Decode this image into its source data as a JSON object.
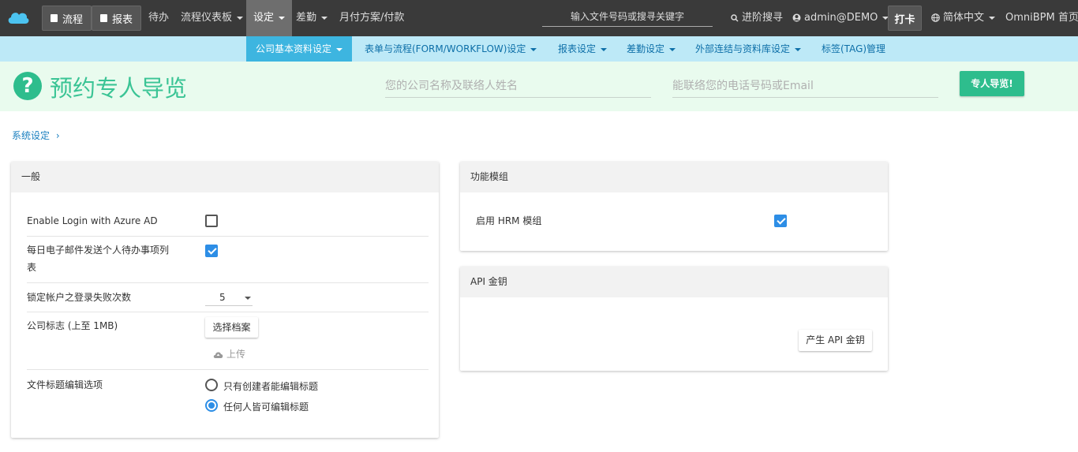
{
  "colors": {
    "topbar": "#3a3a3a",
    "subbar": "#bde9f7",
    "accent": "#3db5e0",
    "banner_bg": "#e9fbee",
    "banner_green": "#2ebd8d",
    "checkbox_blue": "#2d8ee6"
  },
  "topnav": {
    "logo_icon": "cloud-logo-icon",
    "workflow_btn": "流程",
    "report_btn": "报表",
    "todo": "待办",
    "dashboard": "流程仪表板",
    "settings": "设定",
    "attendance": "差勤",
    "billing": "月付方案/付款",
    "search_placeholder": "输入文件号码或搜寻关键字",
    "advanced_search": "进阶搜寻",
    "user": "admin@DEMO",
    "clock_in": "打卡",
    "language": "简体中文",
    "home": "OmniBPM 首页"
  },
  "subnav": {
    "items": [
      "公司基本资料设定",
      "表单与流程(FORM/WORKFLOW)设定",
      "报表设定",
      "差勤设定",
      "外部连结与资料库设定",
      "标签(TAG)管理"
    ]
  },
  "banner": {
    "title": "预约专人导览",
    "name_placeholder": "您的公司名称及联络人姓名",
    "contact_placeholder": "能联络您的电话号码或Email",
    "button": "专人导览!"
  },
  "breadcrumb": {
    "label": "系统设定",
    "separator": "›"
  },
  "general_panel": {
    "title": "一般",
    "azure_label": "Enable Login with Azure AD",
    "azure_checked": false,
    "email_label_line1": "每日电子邮件发送个人待办事项列",
    "email_label_line2": "表",
    "email_checked": true,
    "lock_label": "锁定帐户之登录失败次数",
    "lock_value": "5",
    "logo_label": "公司标志 (上至 1MB)",
    "choose_file": "选择档案",
    "upload": "上传",
    "title_edit_label": "文件标题编辑选项",
    "radio_option1": "只有创建者能编辑标题",
    "radio_option2": "任何人皆可编辑标题",
    "radio_selected": 2
  },
  "modules_panel": {
    "title": "功能模组",
    "hrm_label": "启用 HRM 模组",
    "hrm_checked": true
  },
  "api_panel": {
    "title": "API 金钥",
    "generate_btn": "产生 API 金钥"
  }
}
